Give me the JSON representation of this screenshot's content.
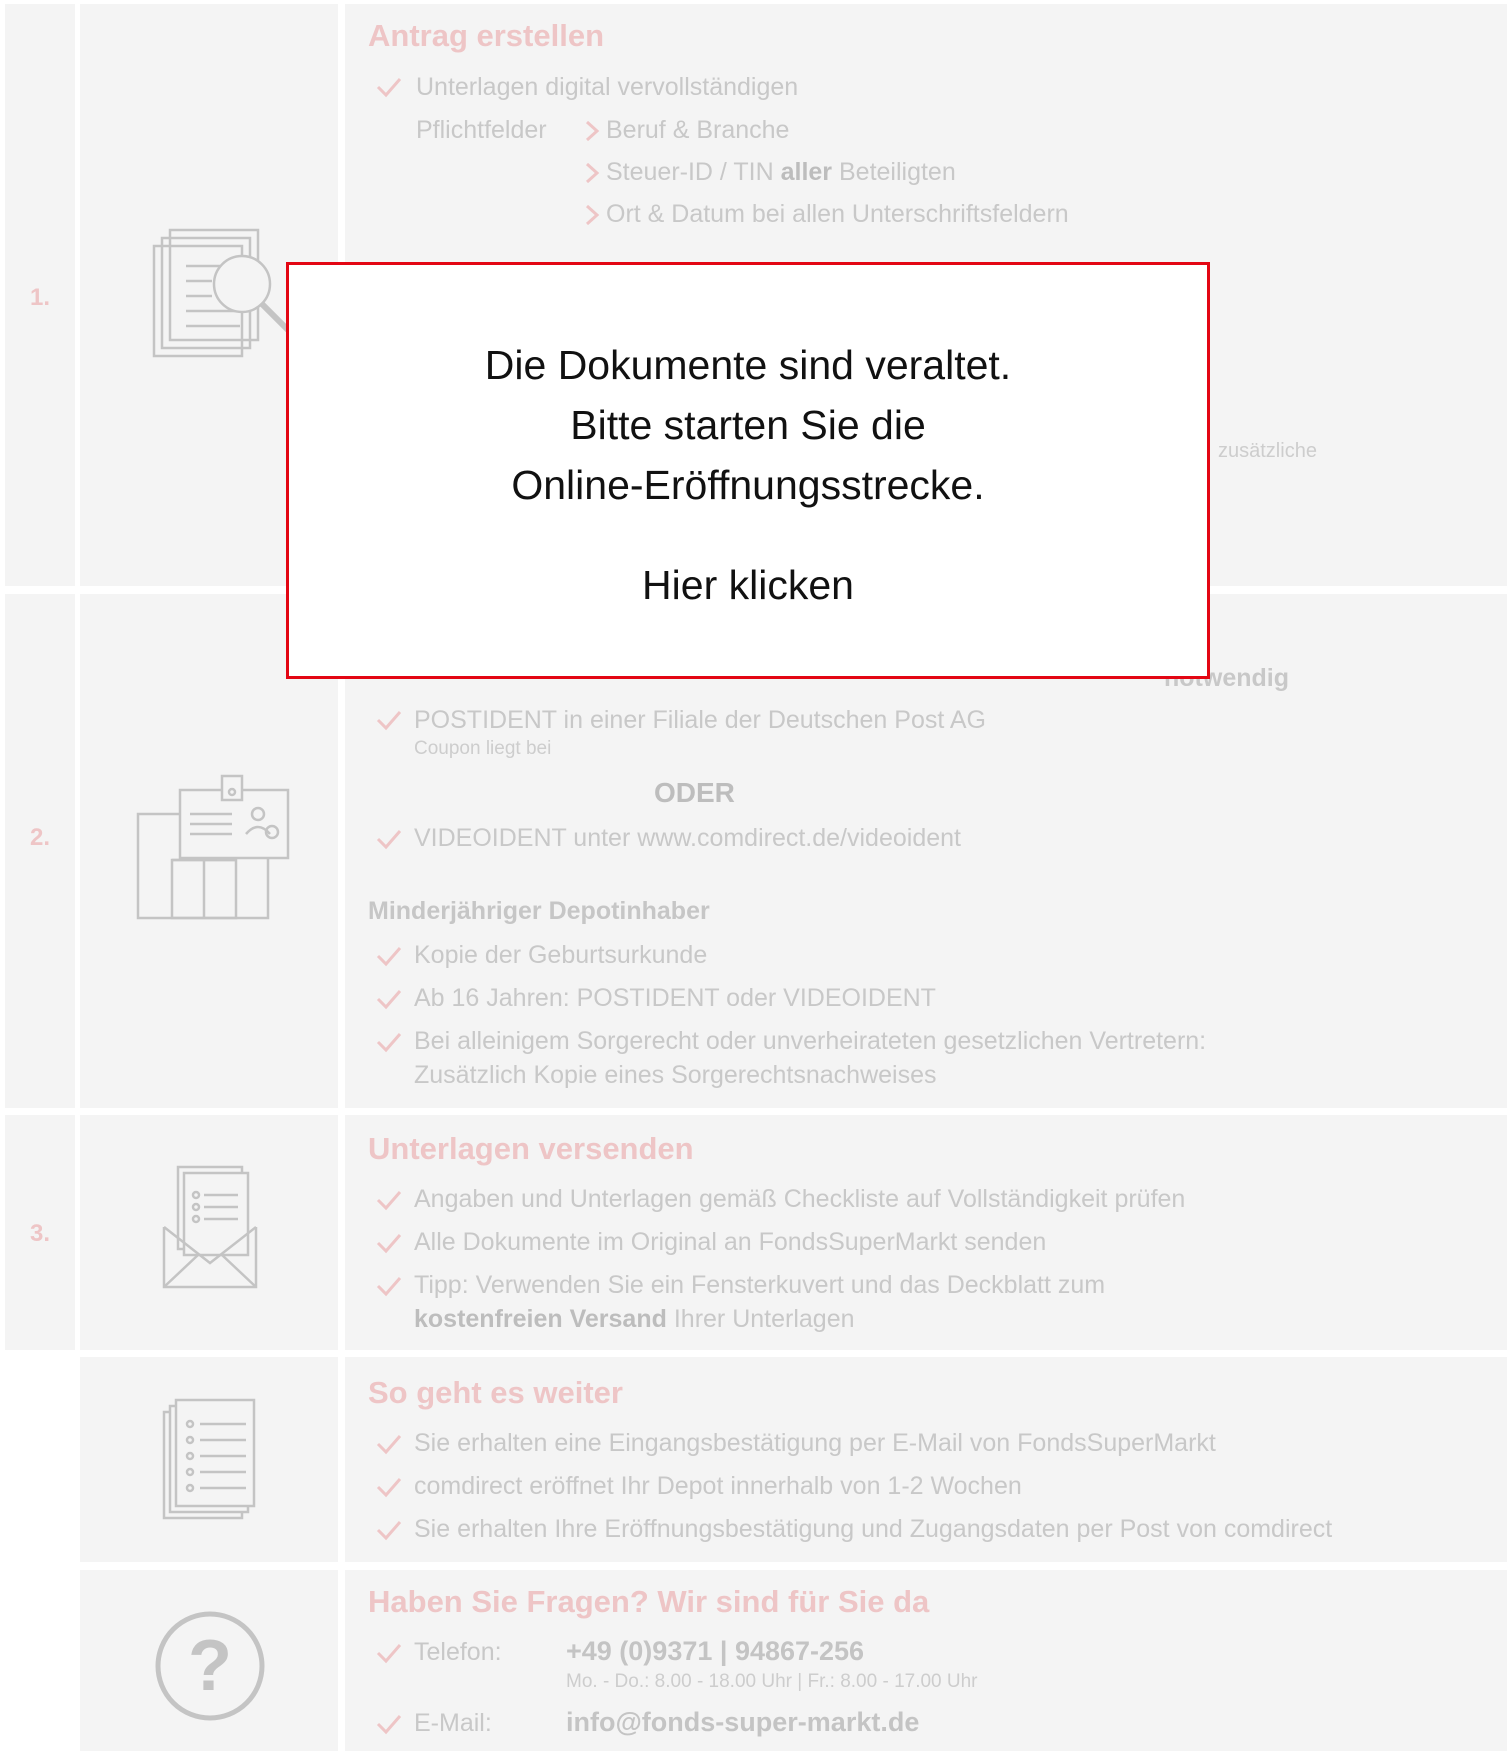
{
  "steps": {
    "s1": {
      "number": "1.",
      "title": "Antrag erstellen",
      "line1": "Unterlagen digital vervollständigen",
      "pflicht_label": "Pflichtfelder",
      "pflicht_items": [
        "Beruf & Branche",
        "Steuer-ID / TIN",
        "Ort & Datum bei allen Unterschriftsfeldern"
      ],
      "pflicht_item2_bold": "aller",
      "pflicht_item2_rest": "Beteiligten",
      "partial_fragment": "zusätzliche"
    },
    "s2": {
      "number": "2.",
      "partial_header": "notwendig",
      "line1": "POSTIDENT in einer Filiale der Deutschen Post AG",
      "line1_note": "Coupon liegt bei",
      "oder": "ODER",
      "line2": "VIDEOIDENT unter www.comdirect.de/videoident",
      "sub_title": "Minderjähriger Depotinhaber",
      "items": [
        "Kopie der Geburtsurkunde",
        "Ab 16 Jahren: POSTIDENT oder VIDEOIDENT",
        "Bei alleinigem Sorgerecht oder unverheirateten gesetzlichen Vertretern:"
      ],
      "item3_cont": "Zusätzlich Kopie eines Sorgerechtsnachweises"
    },
    "s3": {
      "number": "3.",
      "title": "Unterlagen versenden",
      "items": [
        "Angaben und Unterlagen gemäß Checkliste auf Vollständigkeit prüfen",
        "Alle Dokumente im Original an FondsSuperMarkt senden",
        "Tipp: Verwenden Sie ein Fensterkuvert und das Deckblatt zum"
      ],
      "item3_bold": "kostenfreien Versand",
      "item3_rest": "Ihrer Unterlagen"
    },
    "s4": {
      "title": "So geht es weiter",
      "items": [
        "Sie erhalten eine Eingangsbestätigung per E-Mail von FondsSuperMarkt",
        "comdirect eröffnet Ihr Depot innerhalb von 1-2 Wochen",
        "Sie erhalten Ihre Eröffnungsbestätigung und Zugangsdaten per Post von comdirect"
      ]
    },
    "s5": {
      "title": "Haben Sie Fragen? Wir sind für Sie da",
      "phone_label": "Telefon:",
      "phone_a": "+49 (0)9371",
      "phone_b": "94867-256",
      "hours": "Mo. - Do.: 8.00 - 18.00 Uhr | Fr.: 8.00 - 17.00 Uhr",
      "email_label": "E-Mail:",
      "email": "info@fonds-super-markt.de"
    }
  },
  "modal": {
    "line1": "Die Dokumente sind veraltet.",
    "line2": "Bitte starten Sie die",
    "line3": "Online-Eröffnungsstrecke.",
    "link": "Hier klicken"
  },
  "colors": {
    "accent": "#e30613",
    "heading": "#eec5c6",
    "text_faded": "#c8c8c8"
  }
}
